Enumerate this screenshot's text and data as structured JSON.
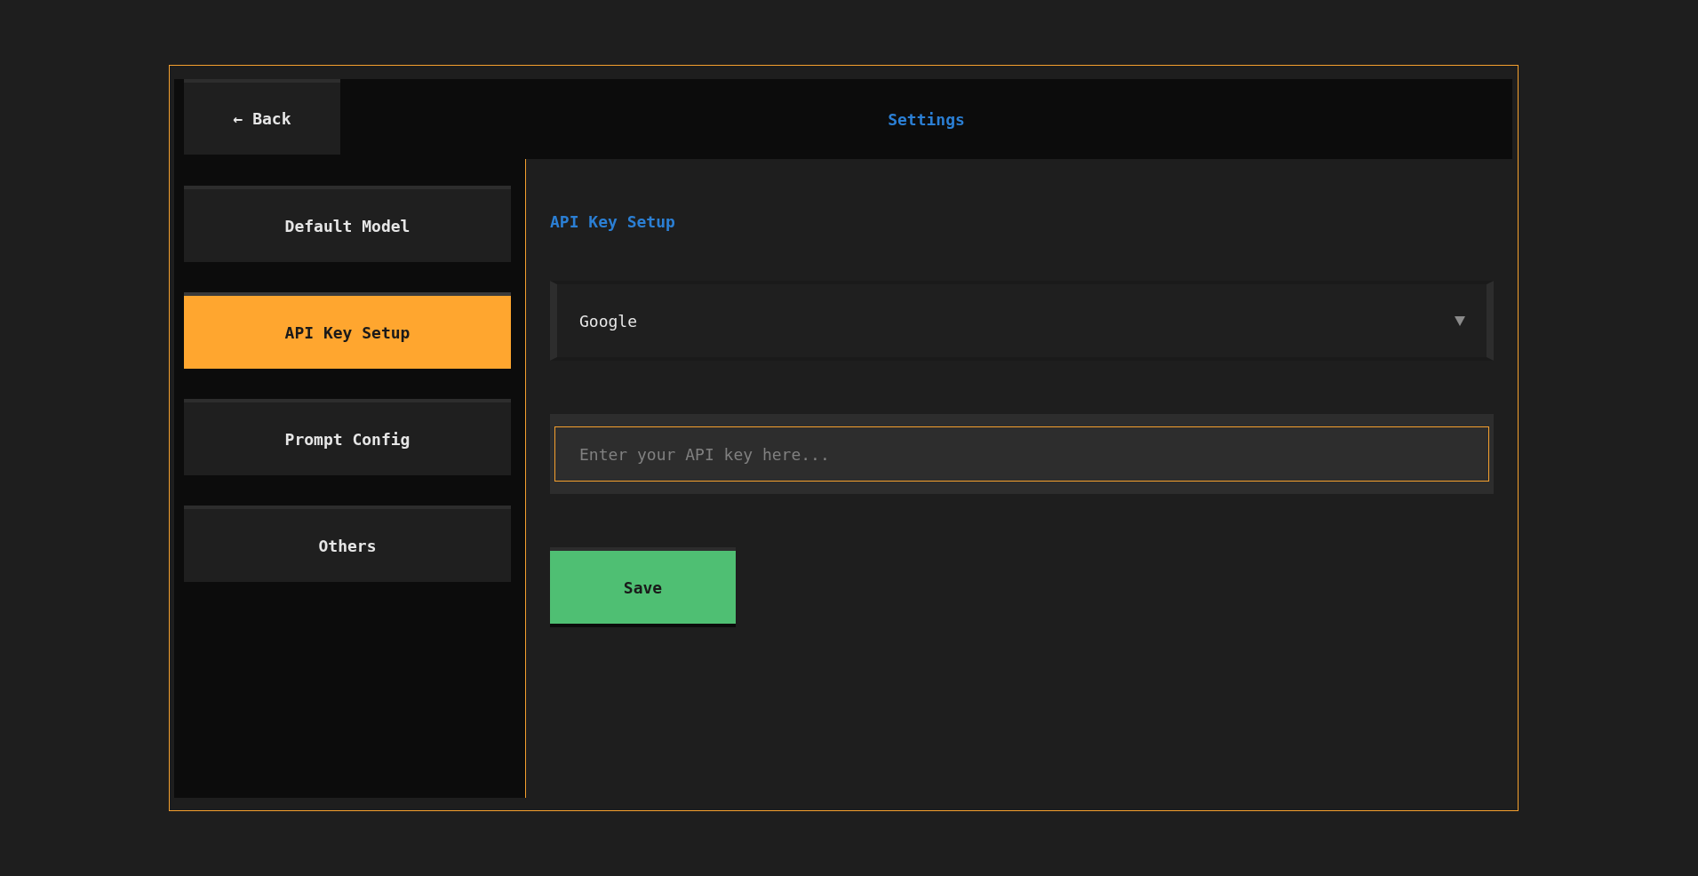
{
  "header": {
    "back_button": "← Back",
    "title": "Settings"
  },
  "sidebar": {
    "items": [
      {
        "label": "Default Model",
        "selected": false
      },
      {
        "label": "API Key Setup",
        "selected": true
      },
      {
        "label": "Prompt Config",
        "selected": false
      },
      {
        "label": "Others",
        "selected": false
      }
    ]
  },
  "main": {
    "heading": "API Key Setup",
    "provider_select": {
      "value": "Google"
    },
    "api_key_field": {
      "placeholder": "Enter your API key here..."
    },
    "save_button": "Save"
  }
}
